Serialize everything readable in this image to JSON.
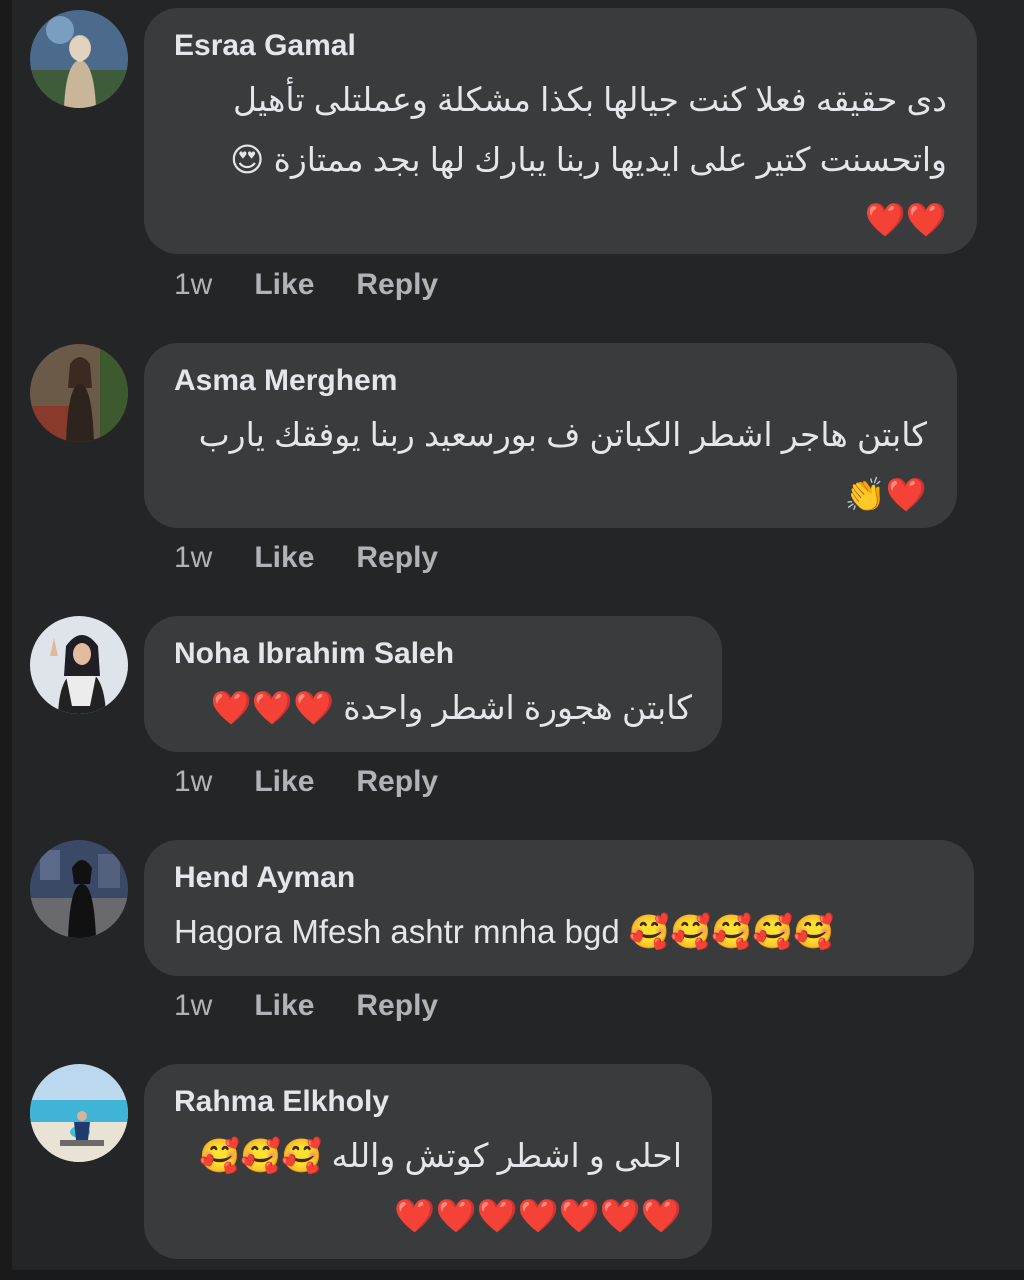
{
  "comments": [
    {
      "author": "Esraa Gamal",
      "lines": [
        "دى حقيقه فعلا كنت جيالها بكذا مشكلة وعملتلى تأهيل",
        "واتحسنت كتير على ايديها ربنا يبارك لها بجد ممتازة 😍",
        "❤️❤️"
      ],
      "time": "1w",
      "like_label": "Like",
      "reply_label": "Reply"
    },
    {
      "author": "Asma Merghem",
      "lines": [
        "كابتن هاجر اشطر الكباتن ف بورسعيد ربنا يوفقك يارب",
        "❤️👏"
      ],
      "time": "1w",
      "like_label": "Like",
      "reply_label": "Reply"
    },
    {
      "author": "Noha Ibrahim Saleh",
      "lines": [
        "كابتن هجورة اشطر واحدة ❤️❤️❤️"
      ],
      "time": "1w",
      "like_label": "Like",
      "reply_label": "Reply"
    },
    {
      "author": "Hend Ayman",
      "lines": [
        "Hagora Mfesh ashtr mnha bgd 🥰🥰🥰🥰🥰"
      ],
      "time": "1w",
      "like_label": "Like",
      "reply_label": "Reply"
    },
    {
      "author": "Rahma Elkholy",
      "lines": [
        "احلى و اشطر كوتش والله 🥰🥰🥰",
        "❤️❤️❤️❤️❤️❤️❤️"
      ]
    }
  ],
  "colors": {
    "background": "#242526",
    "bubble": "#3a3b3c",
    "text": "#e4e6eb",
    "secondary_text": "#b0b3b8"
  }
}
